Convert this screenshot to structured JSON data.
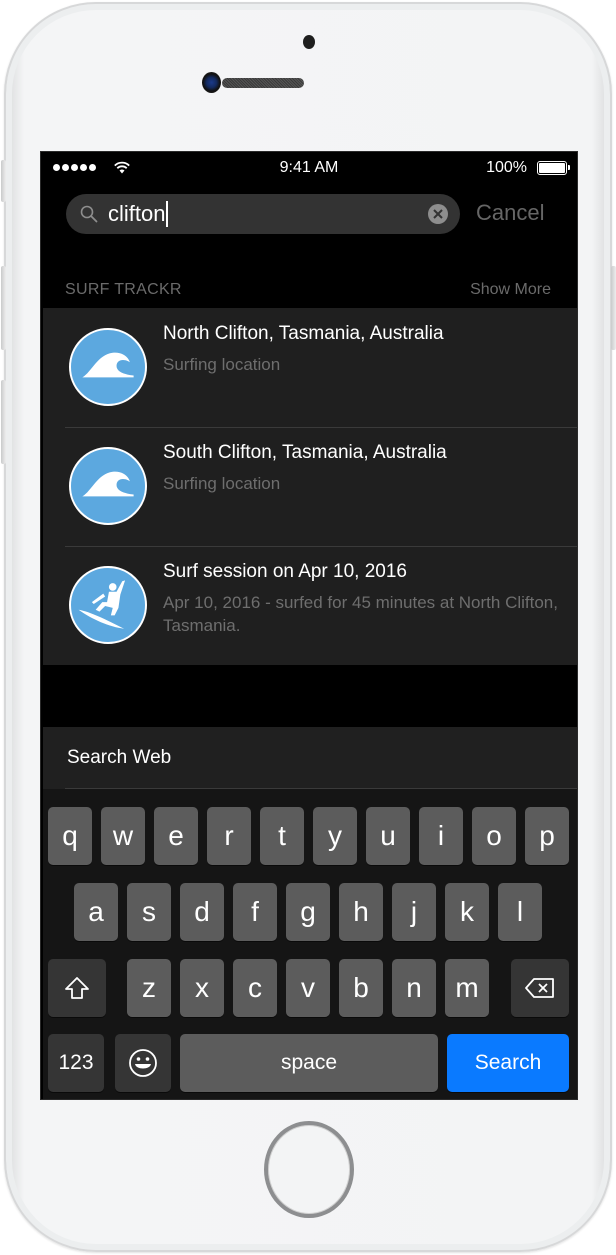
{
  "status_bar": {
    "signal_dots": 5,
    "time": "9:41 AM",
    "battery_percent": "100%",
    "battery_level": 1.0
  },
  "search": {
    "query": "clifton",
    "cancel_label": "Cancel",
    "icon": "search-icon",
    "clear_icon": "clear-circle-icon"
  },
  "section": {
    "title": "SURF TRACKR",
    "show_more_label": "Show More"
  },
  "results": [
    {
      "icon": "wave-icon",
      "title": "North Clifton, Tasmania, Australia",
      "subtitle": "Surfing location"
    },
    {
      "icon": "wave-icon",
      "title": "South Clifton, Tasmania, Australia",
      "subtitle": "Surfing location"
    },
    {
      "icon": "surfer-icon",
      "title": "Surf session on Apr 10, 2016",
      "subtitle": "Apr 10, 2016 - surfed for 45 minutes at North Clifton, Tasmania."
    }
  ],
  "search_web_label": "Search Web",
  "keyboard": {
    "row1": [
      "q",
      "w",
      "e",
      "r",
      "t",
      "y",
      "u",
      "i",
      "o",
      "p"
    ],
    "row2": [
      "a",
      "s",
      "d",
      "f",
      "g",
      "h",
      "j",
      "k",
      "l"
    ],
    "row3": [
      "z",
      "x",
      "c",
      "v",
      "b",
      "n",
      "m"
    ],
    "numbers_label": "123",
    "space_label": "space",
    "return_label": "Search",
    "shift_icon": "shift-icon",
    "delete_icon": "backspace-icon",
    "emoji_icon": "emoji-icon"
  },
  "colors": {
    "accent": "#0a7aff",
    "icon_bg": "#5ca8df"
  }
}
